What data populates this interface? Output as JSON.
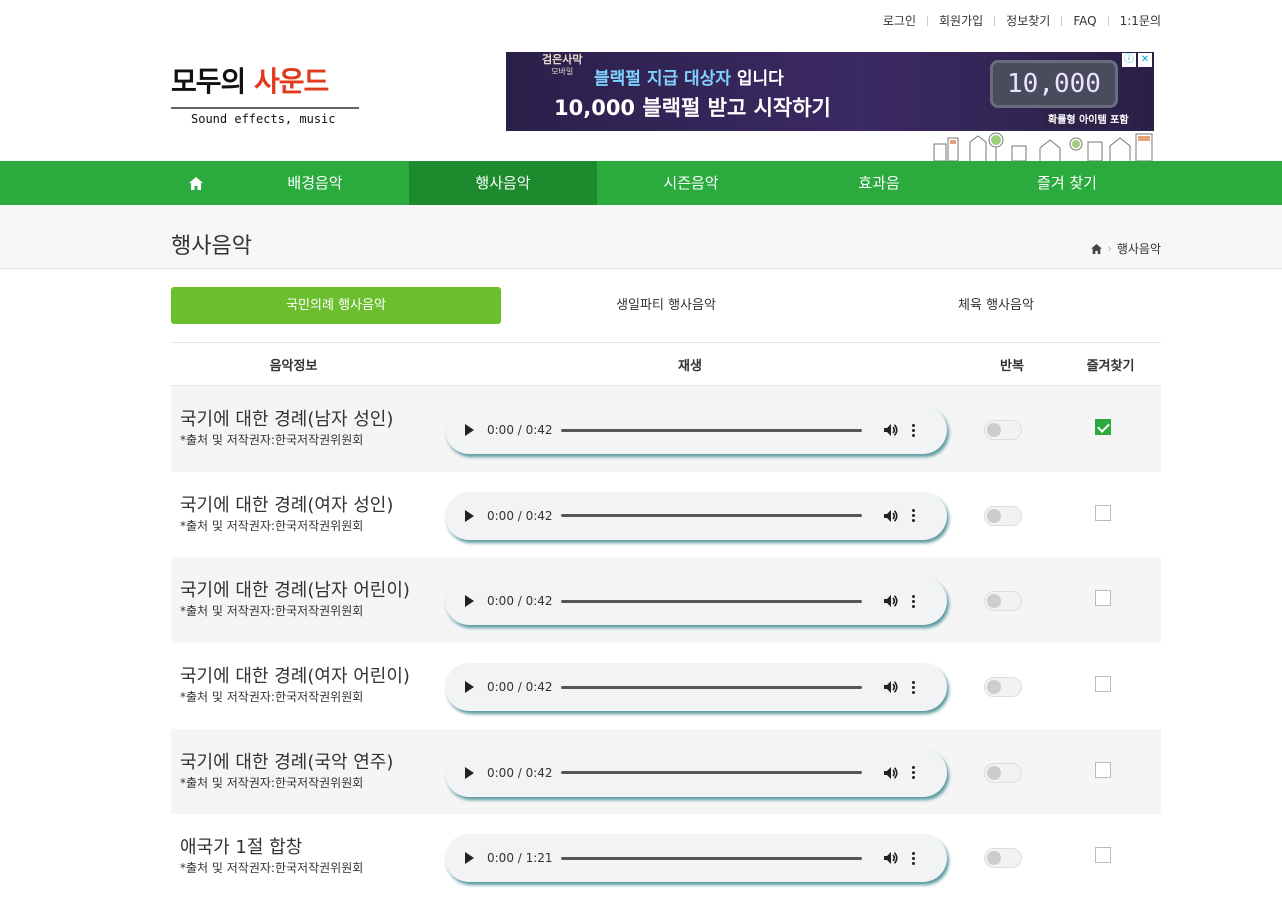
{
  "top_links": {
    "login": "로그인",
    "signup": "회원가입",
    "find_info": "정보찾기",
    "faq": "FAQ",
    "inquiry": "1:1문의"
  },
  "logo": {
    "text_black": "모두의 ",
    "text_red": "사운드",
    "tagline": "Sound effects, music"
  },
  "ad": {
    "brand": "검은사막",
    "brand_sub": "모바일",
    "line1_highlight": "블랙펄 지급 대상자",
    "line1_rest": " 입니다",
    "line2": "10,000 블랙펄 받고 시작하기",
    "counter": "10,000",
    "chip": "확률형 아이템 포함",
    "info_icon": "ⓘ",
    "close_icon": "✕"
  },
  "nav": {
    "home_icon": "home-icon",
    "items": [
      "배경음악",
      "행사음악",
      "시즌음악",
      "효과음",
      "즐겨 찾기"
    ],
    "active_index": 1
  },
  "page": {
    "title": "행사음악",
    "breadcrumb_current": "행사음악",
    "breadcrumb_sep": "›"
  },
  "subtabs": {
    "items": [
      "국민의례 행사음악",
      "생일파티 행사음악",
      "체육 행사음악"
    ],
    "active_index": 0
  },
  "table": {
    "headers": {
      "info": "음악정보",
      "play": "재생",
      "repeat": "반복",
      "favorite": "즐겨찾기"
    },
    "rows": [
      {
        "title": "국기에 대한 경례(남자 성인)",
        "source": "*출처 및 저작권자:한국저작권위원회",
        "time": "0:00 / 0:42",
        "repeat": false,
        "favorite": true
      },
      {
        "title": "국기에 대한 경례(여자 성인)",
        "source": "*출처 및 저작권자:한국저작권위원회",
        "time": "0:00 / 0:42",
        "repeat": false,
        "favorite": false
      },
      {
        "title": "국기에 대한 경례(남자 어린이)",
        "source": "*출처 및 저작권자:한국저작권위원회",
        "time": "0:00 / 0:42",
        "repeat": false,
        "favorite": false
      },
      {
        "title": "국기에 대한 경례(여자 어린이)",
        "source": "*출처 및 저작권자:한국저작권위원회",
        "time": "0:00 / 0:42",
        "repeat": false,
        "favorite": false
      },
      {
        "title": "국기에 대한 경례(국악 연주)",
        "source": "*출처 및 저작권자:한국저작권위원회",
        "time": "0:00 / 0:42",
        "repeat": false,
        "favorite": false
      },
      {
        "title": "애국가 1절 합창",
        "source": "*출처 및 저작권자:한국저작권위원회",
        "time": "0:00 / 1:21",
        "repeat": false,
        "favorite": false
      }
    ]
  },
  "colors": {
    "nav_green": "#2bab3e",
    "nav_active": "#1d8a2e",
    "subtab_active": "#6bbf2f",
    "logo_red": "#e03a1e"
  }
}
